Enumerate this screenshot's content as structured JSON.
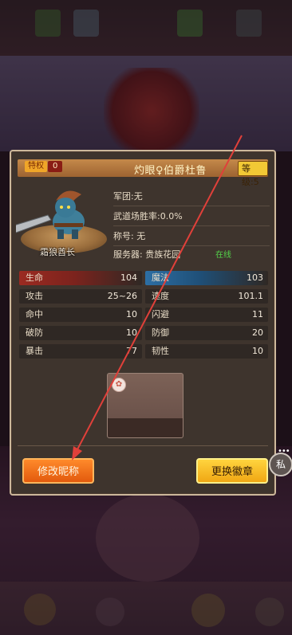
{
  "header": {
    "privilege_label": "特权",
    "privilege_value": "0",
    "player_name": "灼眼♀伯爵杜鲁",
    "level": "等级:5"
  },
  "avatar": {
    "character_name": "霜狼酋长"
  },
  "info": {
    "legion": "军团:无",
    "arena_win_rate": "武道场胜率:0.0%",
    "title": "称号:  无",
    "server": "服务器: 贵族花园",
    "status": "在线"
  },
  "stats": {
    "left": [
      {
        "label": "生命",
        "value": "104"
      },
      {
        "label": "攻击",
        "value": "25~26"
      },
      {
        "label": "命中",
        "value": "10"
      },
      {
        "label": "破防",
        "value": "10"
      },
      {
        "label": "暴击",
        "value": "77"
      }
    ],
    "right": [
      {
        "label": "魔法",
        "value": "103"
      },
      {
        "label": "速度",
        "value": "101.1"
      },
      {
        "label": "闪避",
        "value": "11"
      },
      {
        "label": "防御",
        "value": "20"
      },
      {
        "label": "韧性",
        "value": "10"
      }
    ]
  },
  "buttons": {
    "rename": "修改昵称",
    "change_badge": "更换徽章",
    "private": "私"
  },
  "colors": {
    "rename_button": "#e35a0d",
    "badge_button": "#f0a714",
    "online": "#54d44a",
    "arrow": "#e0403a"
  }
}
